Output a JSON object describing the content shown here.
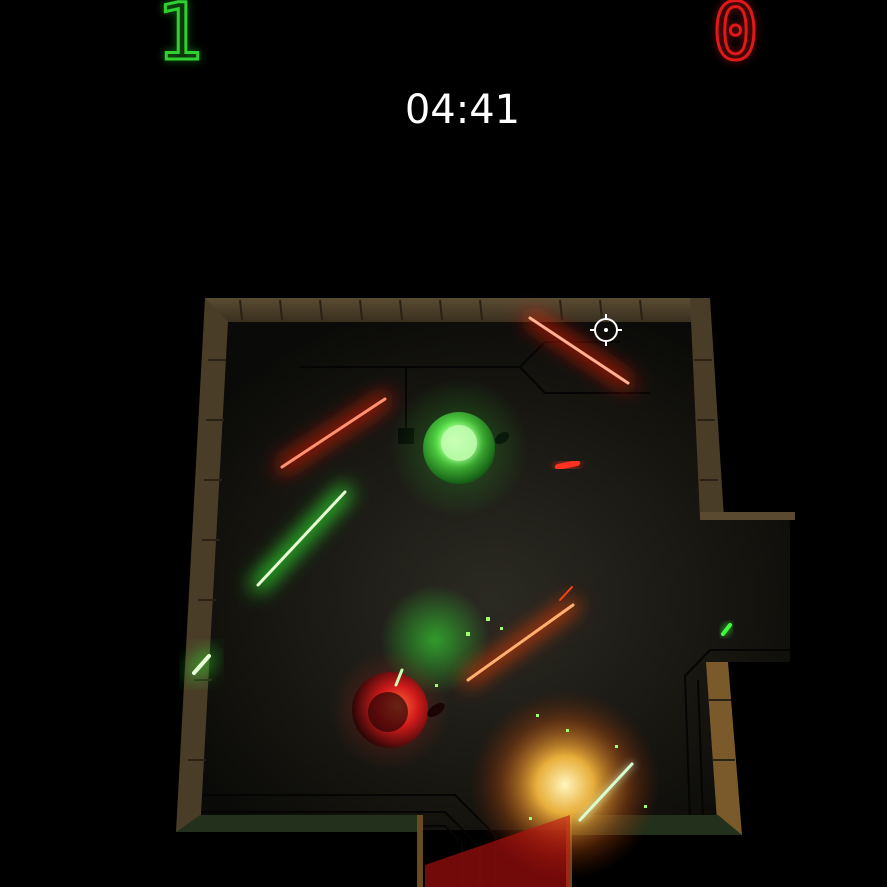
{
  "hud": {
    "score_green": "1",
    "score_red": "0",
    "timer": "04:41"
  },
  "colors": {
    "green_team": "#2fd02f",
    "red_team": "#e01818",
    "timer_text": "#ffffff",
    "background": "#000000",
    "wall": "#6b5a3a"
  },
  "icons": {
    "crosshair": "crosshair-icon"
  }
}
